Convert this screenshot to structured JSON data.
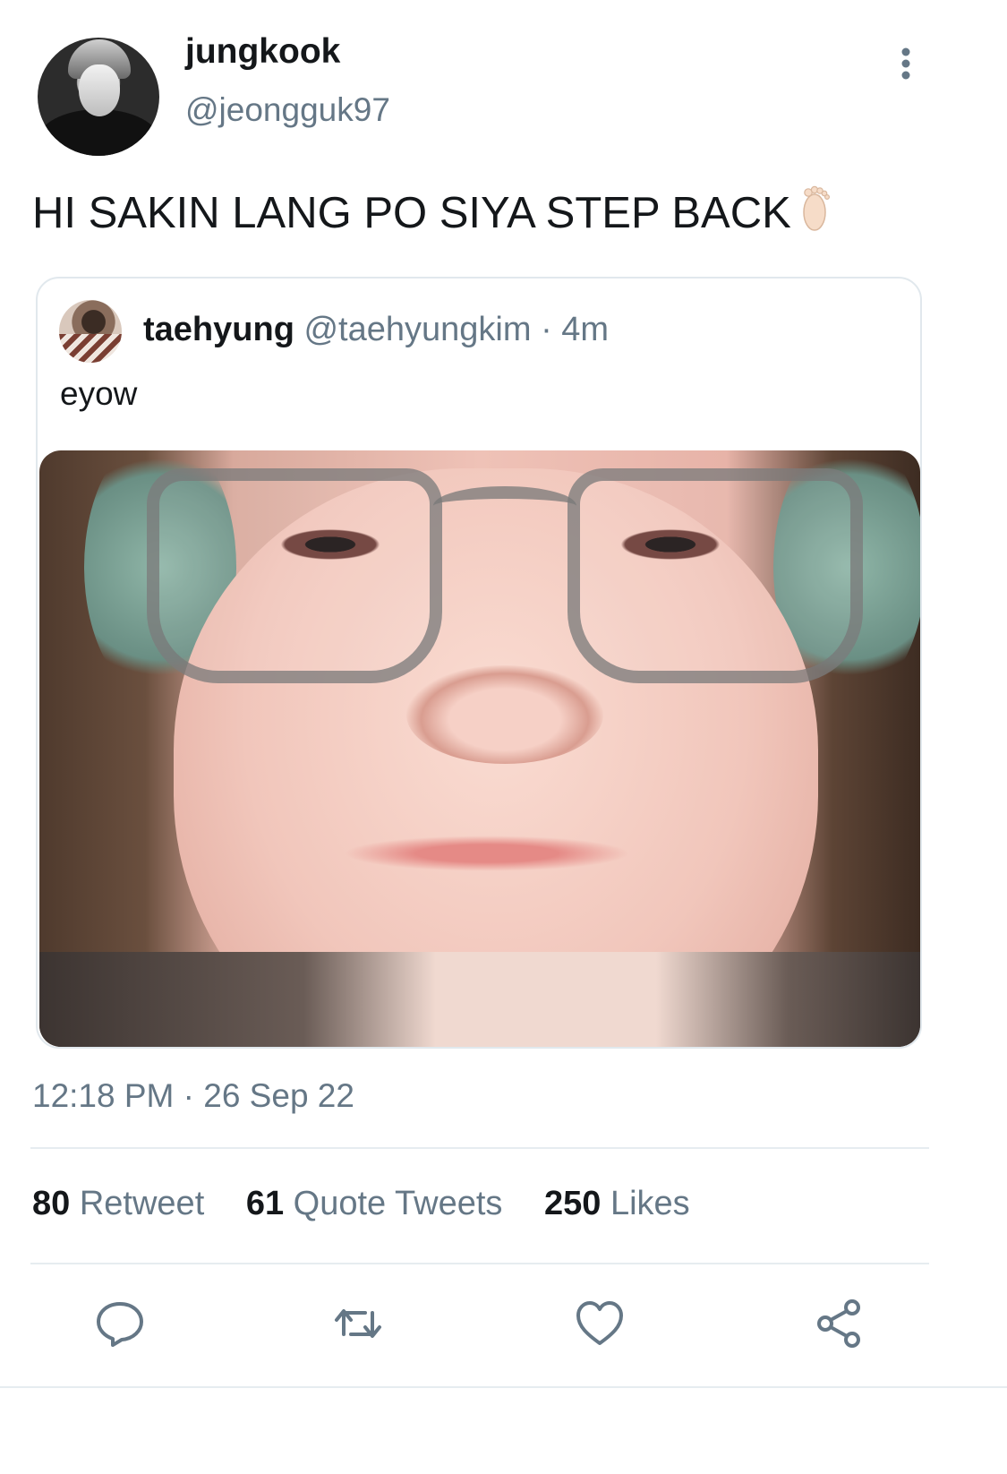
{
  "tweet": {
    "author": {
      "display_name": "jungkook",
      "handle": "@jeongguk97"
    },
    "text": "HI SAKIN LANG PO SIYA STEP BACK",
    "emoji_icon": "foot-icon",
    "timestamp": "12:18 PM · 26 Sep 22"
  },
  "quote": {
    "display_name": "taehyung",
    "handle": "@taehyungkim",
    "separator": " · ",
    "age": "4m",
    "text": "eyow"
  },
  "stats": {
    "retweets": {
      "count": "80",
      "label": "Retweet"
    },
    "quote_tweets": {
      "count": "61",
      "label": "Quote Tweets"
    },
    "likes": {
      "count": "250",
      "label": "Likes"
    }
  },
  "actions": {
    "icons": [
      "reply-icon",
      "retweet-icon",
      "like-icon",
      "share-icon"
    ]
  },
  "colors": {
    "text_primary": "#14171a",
    "text_secondary": "#657786",
    "divider": "#e6ecf0",
    "icon": "#657786"
  }
}
